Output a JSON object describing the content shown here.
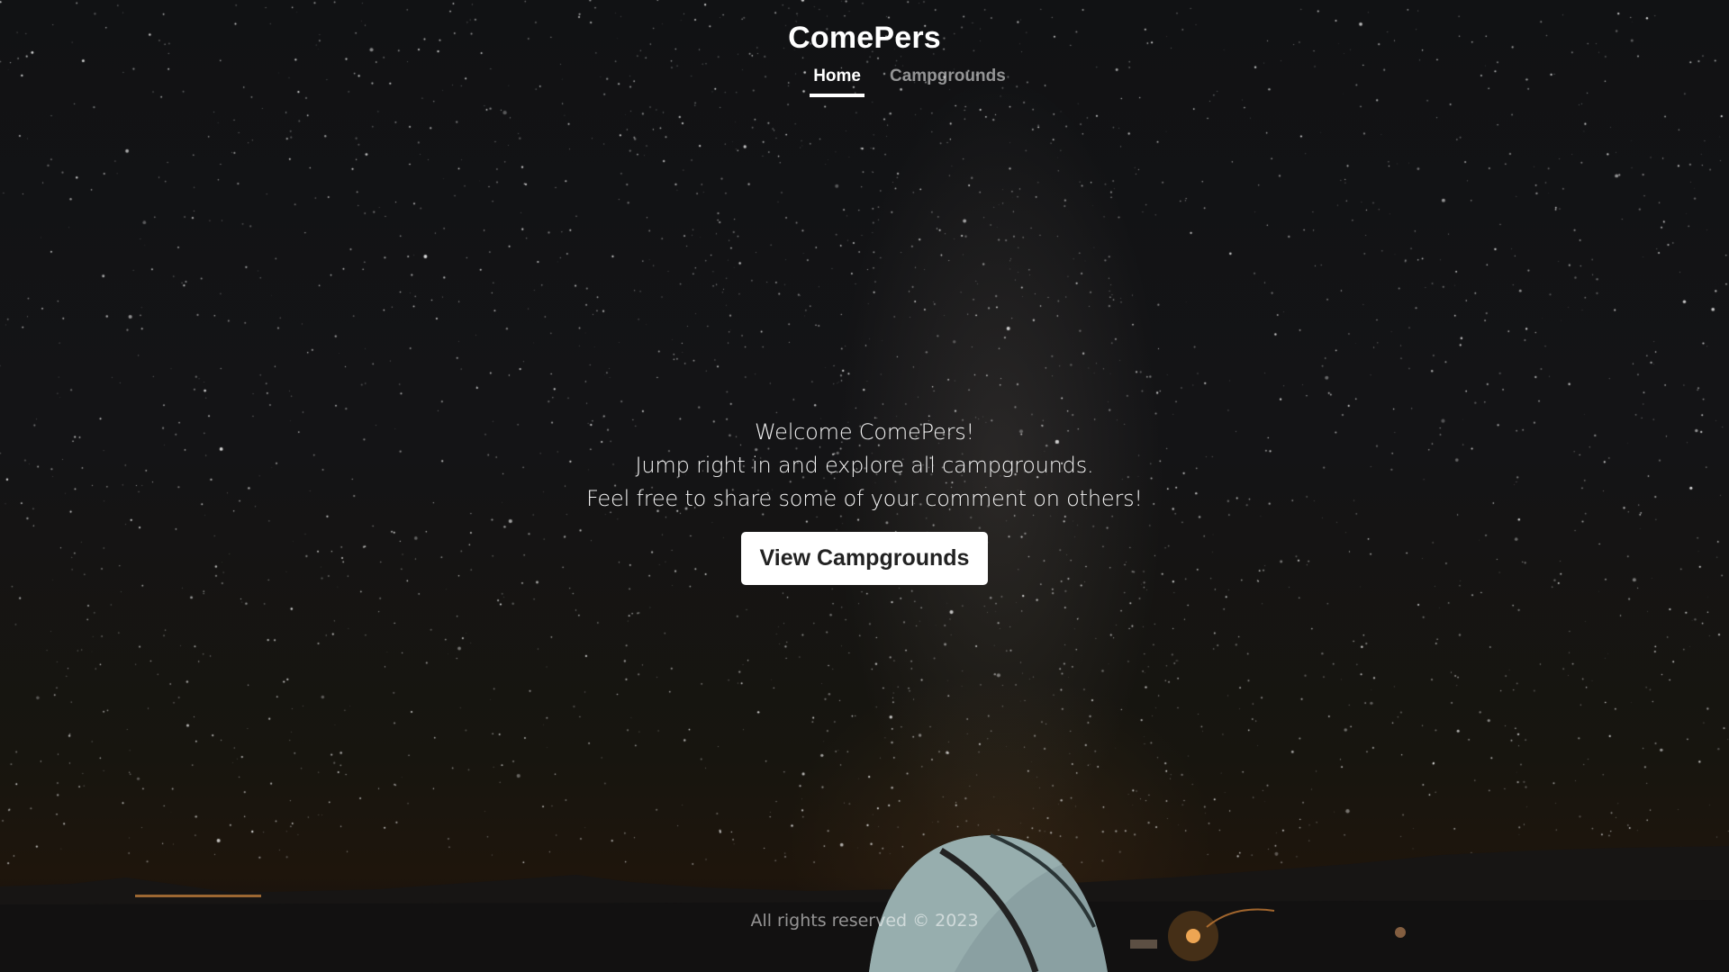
{
  "header": {
    "brand": "ComePers",
    "nav": [
      {
        "label": "Home",
        "active": true
      },
      {
        "label": "Campgrounds",
        "active": false
      }
    ]
  },
  "hero": {
    "line1": "Welcome ComePers!",
    "line2": "Jump right in and explore all campgrounds.",
    "line3": "Feel free to share some of your comment on others!",
    "button_label": "View Campgrounds"
  },
  "footer": {
    "text": "All rights reserved © 2023"
  },
  "colors": {
    "background": "#141416",
    "text": "#ffffff",
    "button_bg": "#ffffff",
    "button_text": "#222222"
  }
}
